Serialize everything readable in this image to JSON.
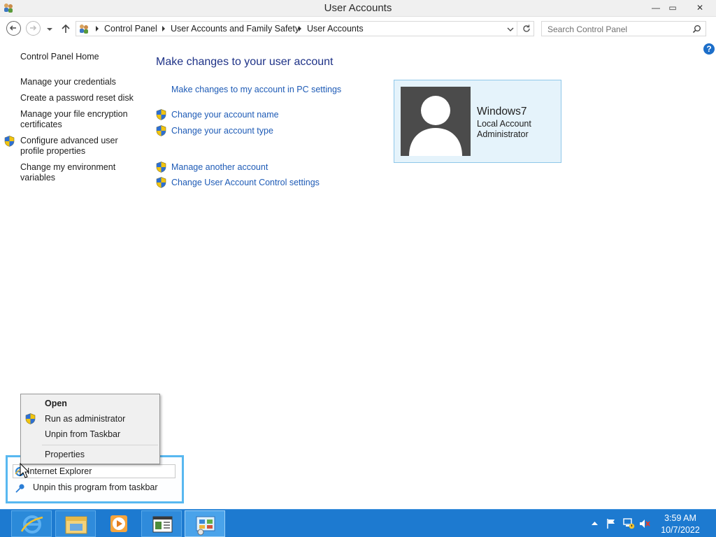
{
  "window": {
    "title": "User Accounts",
    "controls": {
      "minimize": "—",
      "maximize": "▭",
      "close": "✕"
    }
  },
  "address_bar": {
    "breadcrumbs": [
      "Control Panel",
      "User Accounts and Family Safety",
      "User Accounts"
    ],
    "search_placeholder": "Search Control Panel"
  },
  "help": {
    "label": "?"
  },
  "left_pane": {
    "home": "Control Panel Home",
    "links": [
      "Manage your credentials",
      "Create a password reset disk",
      "Manage your file encryption certificates",
      "Configure advanced user profile properties",
      "Change my environment variables"
    ]
  },
  "main": {
    "title": "Make changes to your user account",
    "links": [
      "Make changes to my account in PC settings",
      "Change your account name",
      "Change your account type",
      "Manage another account",
      "Change User Account Control settings"
    ]
  },
  "account": {
    "name": "Windows7",
    "type": "Local Account",
    "role": "Administrator"
  },
  "context_menu": {
    "items": [
      "Open",
      "Run as administrator",
      "Unpin from Taskbar",
      "Properties"
    ]
  },
  "jump_list": {
    "program": "Internet Explorer",
    "unpin": "Unpin this program from taskbar"
  },
  "taskbar": {
    "apps": [
      "internet-explorer-icon",
      "file-explorer-icon",
      "media-player-icon",
      "document-app-icon",
      "control-panel-icon"
    ],
    "clock": {
      "time": "3:59 AM",
      "date": "10/7/2022"
    }
  },
  "colors": {
    "link": "#1e5bb6",
    "heading": "#1e3287",
    "taskbar": "#1d7ad0",
    "tile_bg": "#e5f3fb",
    "tile_border": "#8fc7e9"
  }
}
